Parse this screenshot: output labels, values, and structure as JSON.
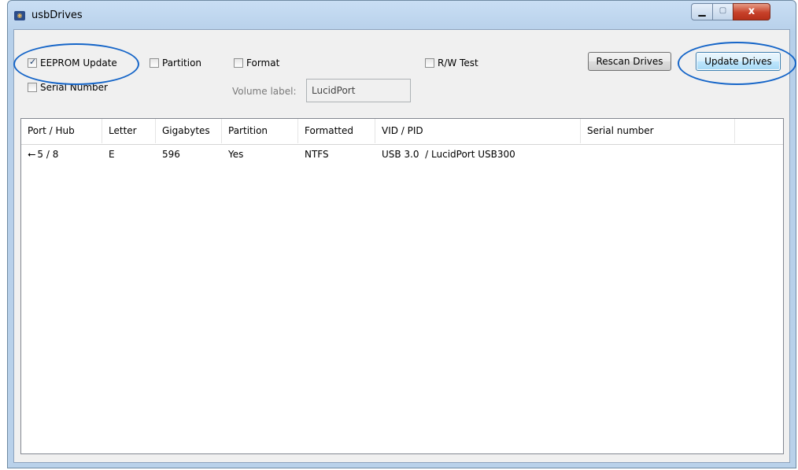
{
  "window": {
    "title": "usbDrives",
    "close_glyph": "x",
    "app_icon": "usb-drives-app-icon"
  },
  "options": {
    "eeprom_update": {
      "label": "EEPROM Update",
      "checked": true
    },
    "partition": {
      "label": "Partition",
      "checked": false
    },
    "format": {
      "label": "Format",
      "checked": false
    },
    "rw_test": {
      "label": "R/W Test",
      "checked": false
    },
    "serial_number": {
      "label": "Serial Number",
      "checked": false
    }
  },
  "volume": {
    "label": "Volume label:",
    "value": "LucidPort"
  },
  "buttons": {
    "rescan": "Rescan Drives",
    "update": "Update Drives"
  },
  "table": {
    "columns": [
      "Port / Hub",
      "Letter",
      "Gigabytes",
      "Partition",
      "Formatted",
      "VID / PID",
      "Serial number"
    ],
    "rows": [
      {
        "port_hub": "5 / 8",
        "port_icon": "usb-icon",
        "letter": "E",
        "gigabytes": "596",
        "partition": "Yes",
        "formatted": "NTFS",
        "vid_pid": "USB 3.0  / LucidPort USB300",
        "serial": ""
      }
    ]
  },
  "colors": {
    "highlight_ellipse": "#1565c8",
    "title_bar": "#c9def4",
    "close_button": "#c7412a"
  }
}
